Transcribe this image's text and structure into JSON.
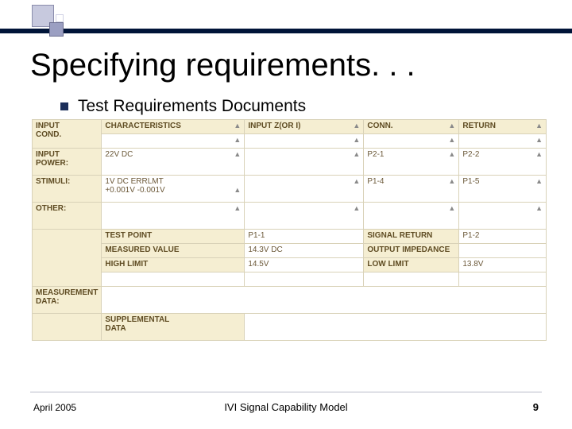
{
  "slide": {
    "title": "Specifying requirements. . .",
    "bullet": "Test Requirements Documents"
  },
  "table": {
    "col_headers": {
      "c1": "CHARACTERISTICS",
      "c2": "INPUT Z(OR I)",
      "c3": "CONN.",
      "c4": "RETURN"
    },
    "rows": {
      "r1": {
        "label": "INPUT\nCOND.",
        "c1": "",
        "c2": "",
        "c3": "",
        "c4": ""
      },
      "r2": {
        "label": "INPUT\nPOWER:",
        "c1": "22V DC",
        "c2": "",
        "c3": "P2-1",
        "c4": "P2-2"
      },
      "r3": {
        "label": "STIMULI:",
        "c1": "1V DC ERRLMT\n+0.001V -0.001V",
        "c2": "",
        "c3": "P1-4",
        "c4": "P1-5"
      },
      "r4": {
        "label": "OTHER:",
        "c1": "",
        "c2": "",
        "c3": "",
        "c4": ""
      }
    },
    "lower": {
      "l1": {
        "a": "TEST POINT",
        "b": "P1-1",
        "c": "SIGNAL RETURN",
        "d": "P1-2"
      },
      "l2": {
        "a": "MEASURED VALUE",
        "b": "14.3V DC",
        "c": "OUTPUT IMPEDANCE",
        "d": ""
      },
      "l3": {
        "a": "HIGH LIMIT",
        "b": "14.5V",
        "c": "LOW LIMIT",
        "d": "13.8V"
      },
      "side": "MEASUREMENT\nDATA:",
      "supp": "SUPPLEMENTAL\nDATA"
    }
  },
  "footer": {
    "date": "April 2005",
    "center": "IVI Signal Capability Model",
    "page": "9"
  },
  "glyph": {
    "up": "▲"
  }
}
